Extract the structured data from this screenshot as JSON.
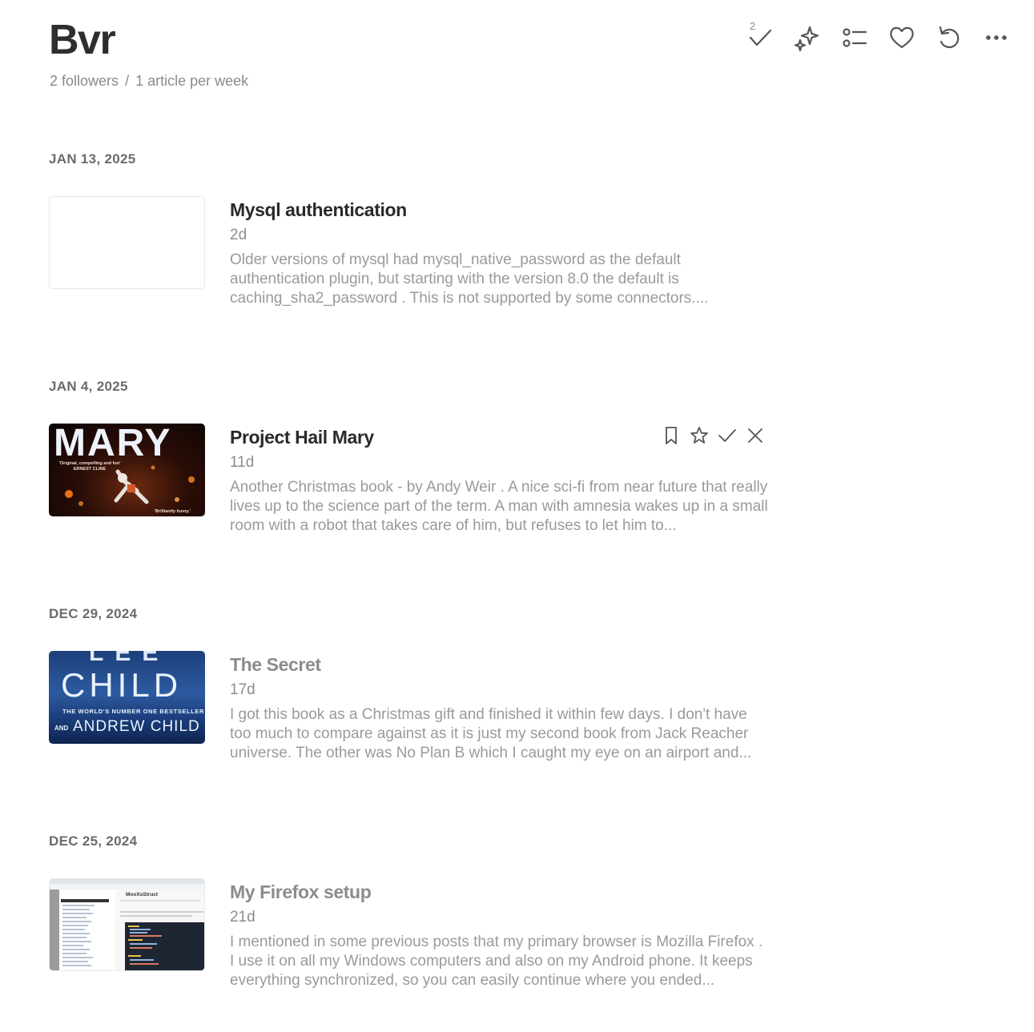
{
  "feed": {
    "title": "Bvr",
    "followers": "2 followers",
    "separator": "/",
    "frequency": "1 article per week"
  },
  "toolbar": {
    "unread_count": "2",
    "icons": [
      "check-icon",
      "sparkle-icon",
      "list-view-icon",
      "heart-icon",
      "refresh-icon",
      "more-icon"
    ]
  },
  "entries": [
    {
      "date": "JAN 13, 2025",
      "title": "Mysql authentication",
      "age": "2d",
      "summary": "Older versions of mysql had mysql_native_password as the default authentication plugin, but starting with the version 8.0 the default is caching_sha2_password . This is not supported by some connectors....",
      "read": false
    },
    {
      "date": "JAN 4, 2025",
      "title": "Project Hail Mary",
      "age": "11d",
      "summary": "Another Christmas book - by Andy Weir . A nice sci-fi from near future that really lives up to the science part of the term. A man with amnesia wakes up in a small room with a robot that takes care of him, but refuses to let him to...",
      "read": false,
      "thumb_text": {
        "main": "MARY",
        "quote": "'Original, compelling and fun' ERNEST CLINE",
        "corner": "'Brilliantly funny.'"
      },
      "actions": [
        "bookmark-icon",
        "star-icon",
        "check-icon",
        "close-icon"
      ]
    },
    {
      "date": "DEC 29, 2024",
      "title": "The Secret",
      "age": "17d",
      "summary": "I got this book as a Christmas gift and finished it within few days. I don't have too much to compare against as it is just my second book from Jack Reacher universe. The other was No Plan B which I caught my eye on an airport and...",
      "read": true,
      "thumb_text": {
        "top": "LEE",
        "main": "CHILD",
        "tagline": "THE WORLD'S NUMBER ONE BESTSELLER",
        "and": "AND",
        "coauthor": "ANDREW CHILD"
      }
    },
    {
      "date": "DEC 25, 2024",
      "title": "My Firefox setup",
      "age": "21d",
      "summary": "I mentioned in some previous posts that my primary browser is Mozilla Firefox . I use it on all my Windows computers and also on my Android phone. It keeps everything synchronized, so you can easily continue where you ended...",
      "read": true,
      "thumb_text": {
        "heading": "MooXsStruct"
      }
    }
  ]
}
